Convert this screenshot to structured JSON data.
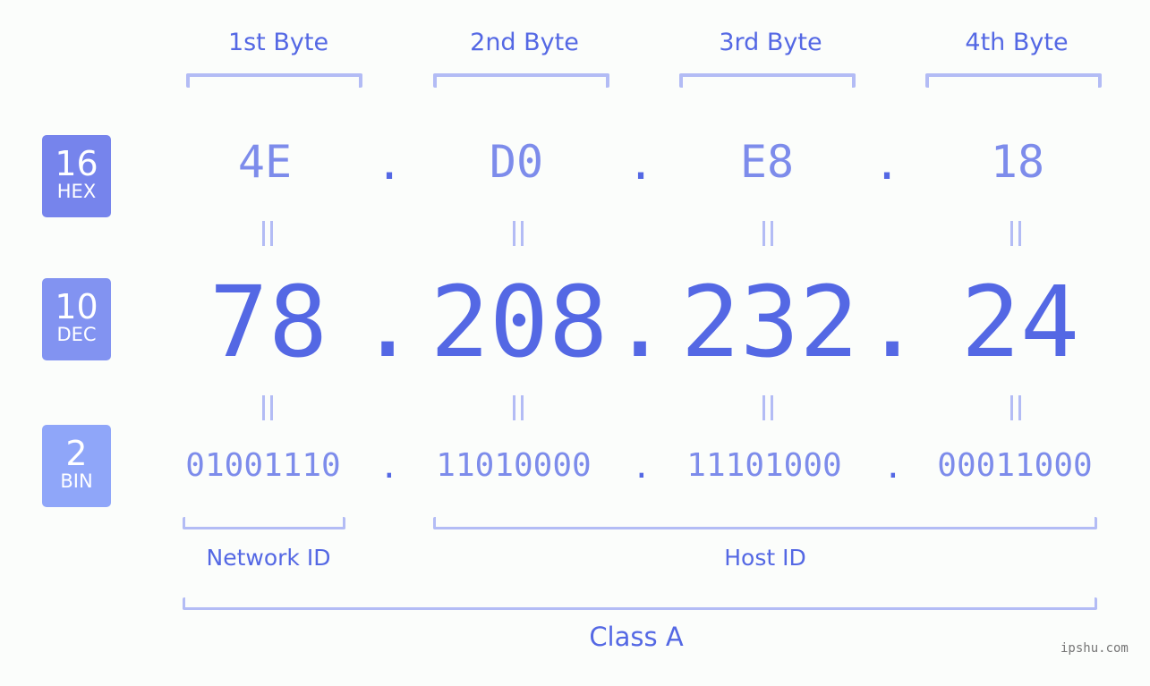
{
  "byte_headers": [
    "1st Byte",
    "2nd Byte",
    "3rd Byte",
    "4th Byte"
  ],
  "badges": {
    "hex": {
      "number": "16",
      "label": "HEX",
      "color": "#7684ec"
    },
    "dec": {
      "number": "10",
      "label": "DEC",
      "color": "#8293f1"
    },
    "bin": {
      "number": "2",
      "label": "BIN",
      "color": "#8fa6f9"
    }
  },
  "hex": [
    "4E",
    "D0",
    "E8",
    "18"
  ],
  "dec": [
    "78",
    "208",
    "232",
    "24"
  ],
  "bin": [
    "01001110",
    "11010000",
    "11101000",
    "00011000"
  ],
  "separator": ".",
  "segments": {
    "network": "Network ID",
    "host": "Host ID",
    "class": "Class A"
  },
  "watermark": "ipshu.com",
  "colors": {
    "accent": "#5468e4",
    "light": "#7d8ceb",
    "bracket": "#b3bcf5",
    "background": "#fbfdfb"
  }
}
